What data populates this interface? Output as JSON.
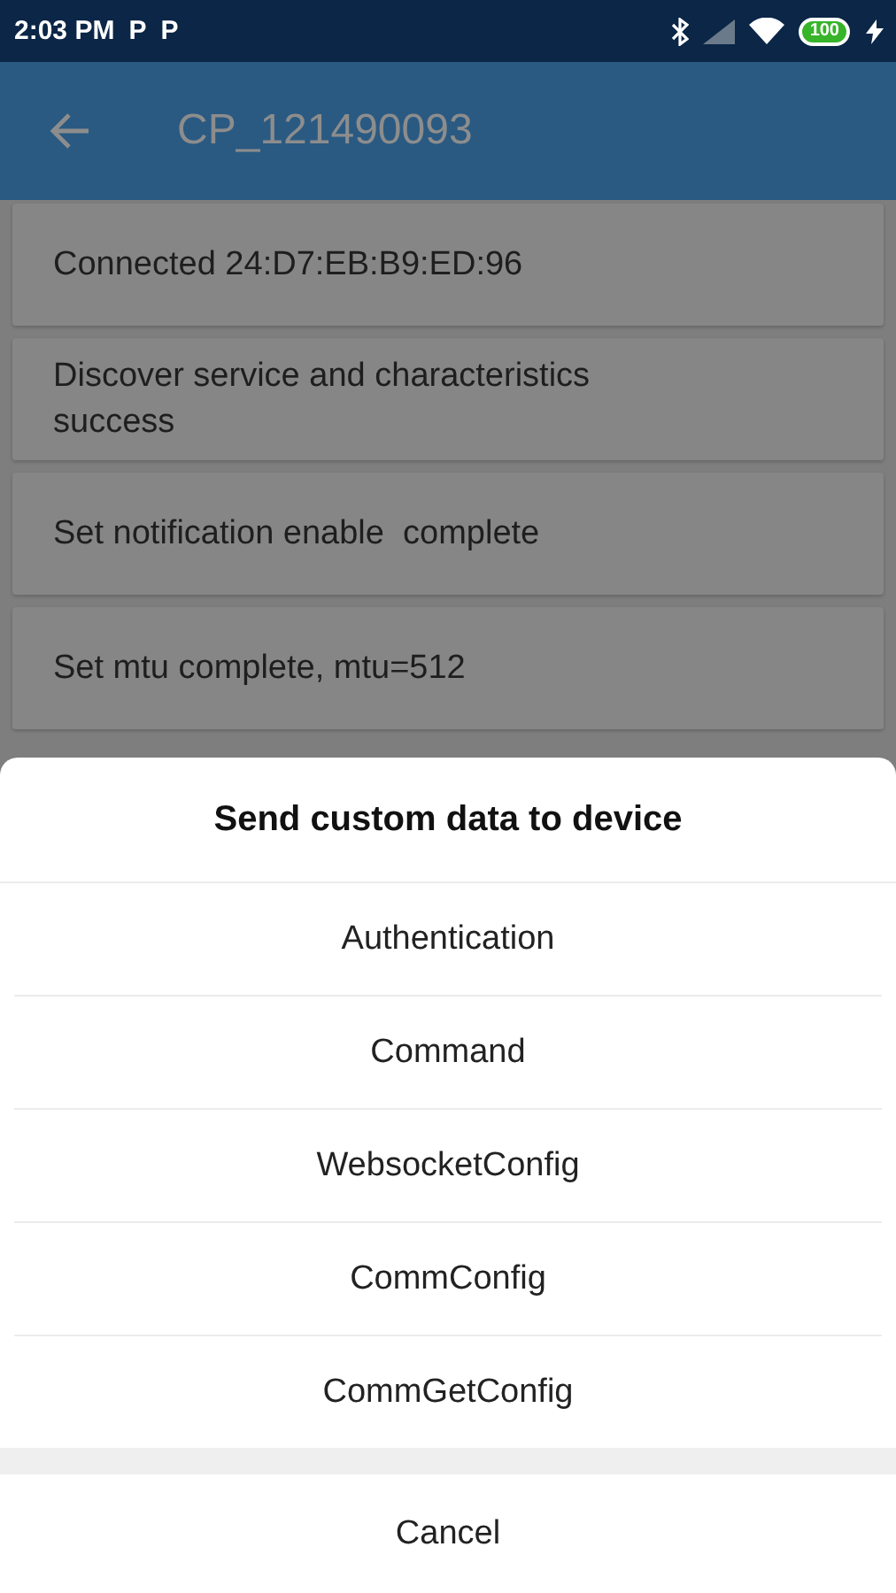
{
  "status_bar": {
    "time": "2:03 PM",
    "notification_icons": [
      "P",
      "P"
    ],
    "battery": "100"
  },
  "app_bar": {
    "title": "CP_121490093"
  },
  "log_items": [
    {
      "text": "Connected 24:D7:EB:B9:ED:96"
    },
    {
      "text": "Discover service and characteristics success"
    },
    {
      "text": "Set notification enable  complete"
    },
    {
      "text": "Set mtu complete, mtu=512"
    }
  ],
  "sheet": {
    "title": "Send custom data to device",
    "options": [
      "Authentication",
      "Command",
      "WebsocketConfig",
      "CommConfig",
      "CommGetConfig"
    ],
    "cancel": "Cancel"
  }
}
